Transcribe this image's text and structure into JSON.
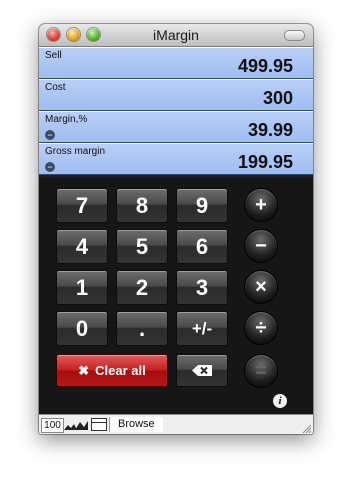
{
  "window": {
    "title": "iMargin"
  },
  "fields": [
    {
      "label": "Sell",
      "value": "499.95",
      "has_icon": false
    },
    {
      "label": "Cost",
      "value": "300",
      "has_icon": false
    },
    {
      "label": "Margin,%",
      "value": "39.99",
      "has_icon": true
    },
    {
      "label": "Gross margin",
      "value": "199.95",
      "has_icon": true
    }
  ],
  "keypad": {
    "digits": [
      [
        "7",
        "8",
        "9"
      ],
      [
        "4",
        "5",
        "6"
      ],
      [
        "1",
        "2",
        "3"
      ],
      [
        "0",
        ".",
        "+/-"
      ]
    ],
    "operators": [
      "+",
      "−",
      "×",
      "÷",
      "="
    ],
    "clear_label": "Clear all",
    "clear_icon": "x-icon",
    "backspace_icon": "backspace-icon",
    "info_label": "i"
  },
  "statusbar": {
    "zoom": "100",
    "mode": "Browse"
  }
}
